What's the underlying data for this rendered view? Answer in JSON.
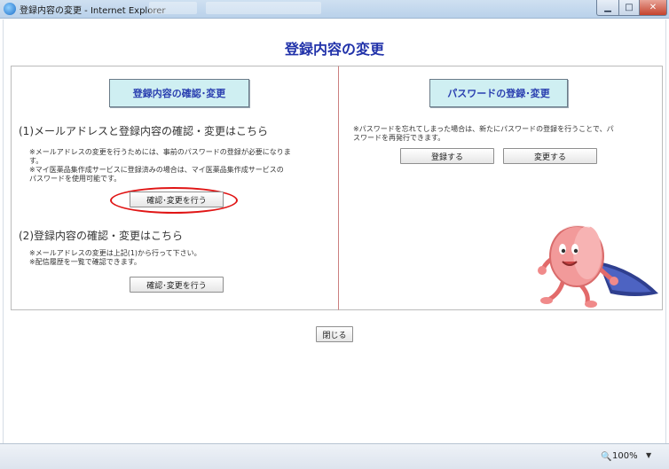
{
  "window": {
    "title": "登録内容の変更 - Internet Explorer",
    "minimize_icon": "minimize-icon",
    "maximize_icon": "maximize-icon",
    "close_icon": "close-icon"
  },
  "page": {
    "title": "登録内容の変更"
  },
  "left_panel": {
    "header": "登録内容の確認･変更",
    "section1": {
      "heading": "(1)メールアドレスと登録内容の確認・変更はこちら",
      "note_lines": [
        "※メールアドレスの変更を行うためには、事前のパスワードの登録が必要になりま",
        "す。",
        "※マイ医薬品集作成サービスに登録済みの場合は、マイ医薬品集作成サービスの",
        "パスワードを使用可能です。"
      ],
      "button": "確認･変更を行う"
    },
    "section2": {
      "heading": "(2)登録内容の確認・変更はこちら",
      "note_lines": [
        "※メールアドレスの変更は上記(1)から行って下さい。",
        "※配信履歴を一覧で確認できます。"
      ],
      "button": "確認･変更を行う"
    }
  },
  "right_panel": {
    "header": "パスワードの登録･変更",
    "note_lines": [
      "※パスワードを忘れてしまった場合は、新たにパスワードの登録を行うことで、パ",
      "スワードを再発行できます。"
    ],
    "register_button": "登録する",
    "change_button": "変更する"
  },
  "footer": {
    "close_button": "閉じる"
  },
  "status_bar": {
    "zoom_icon": "zoom-icon",
    "zoom_level": "100%"
  },
  "colors": {
    "title_blue": "#2233aa",
    "header_box_bg": "#cfeff2",
    "highlight_ring": "#e01515"
  }
}
